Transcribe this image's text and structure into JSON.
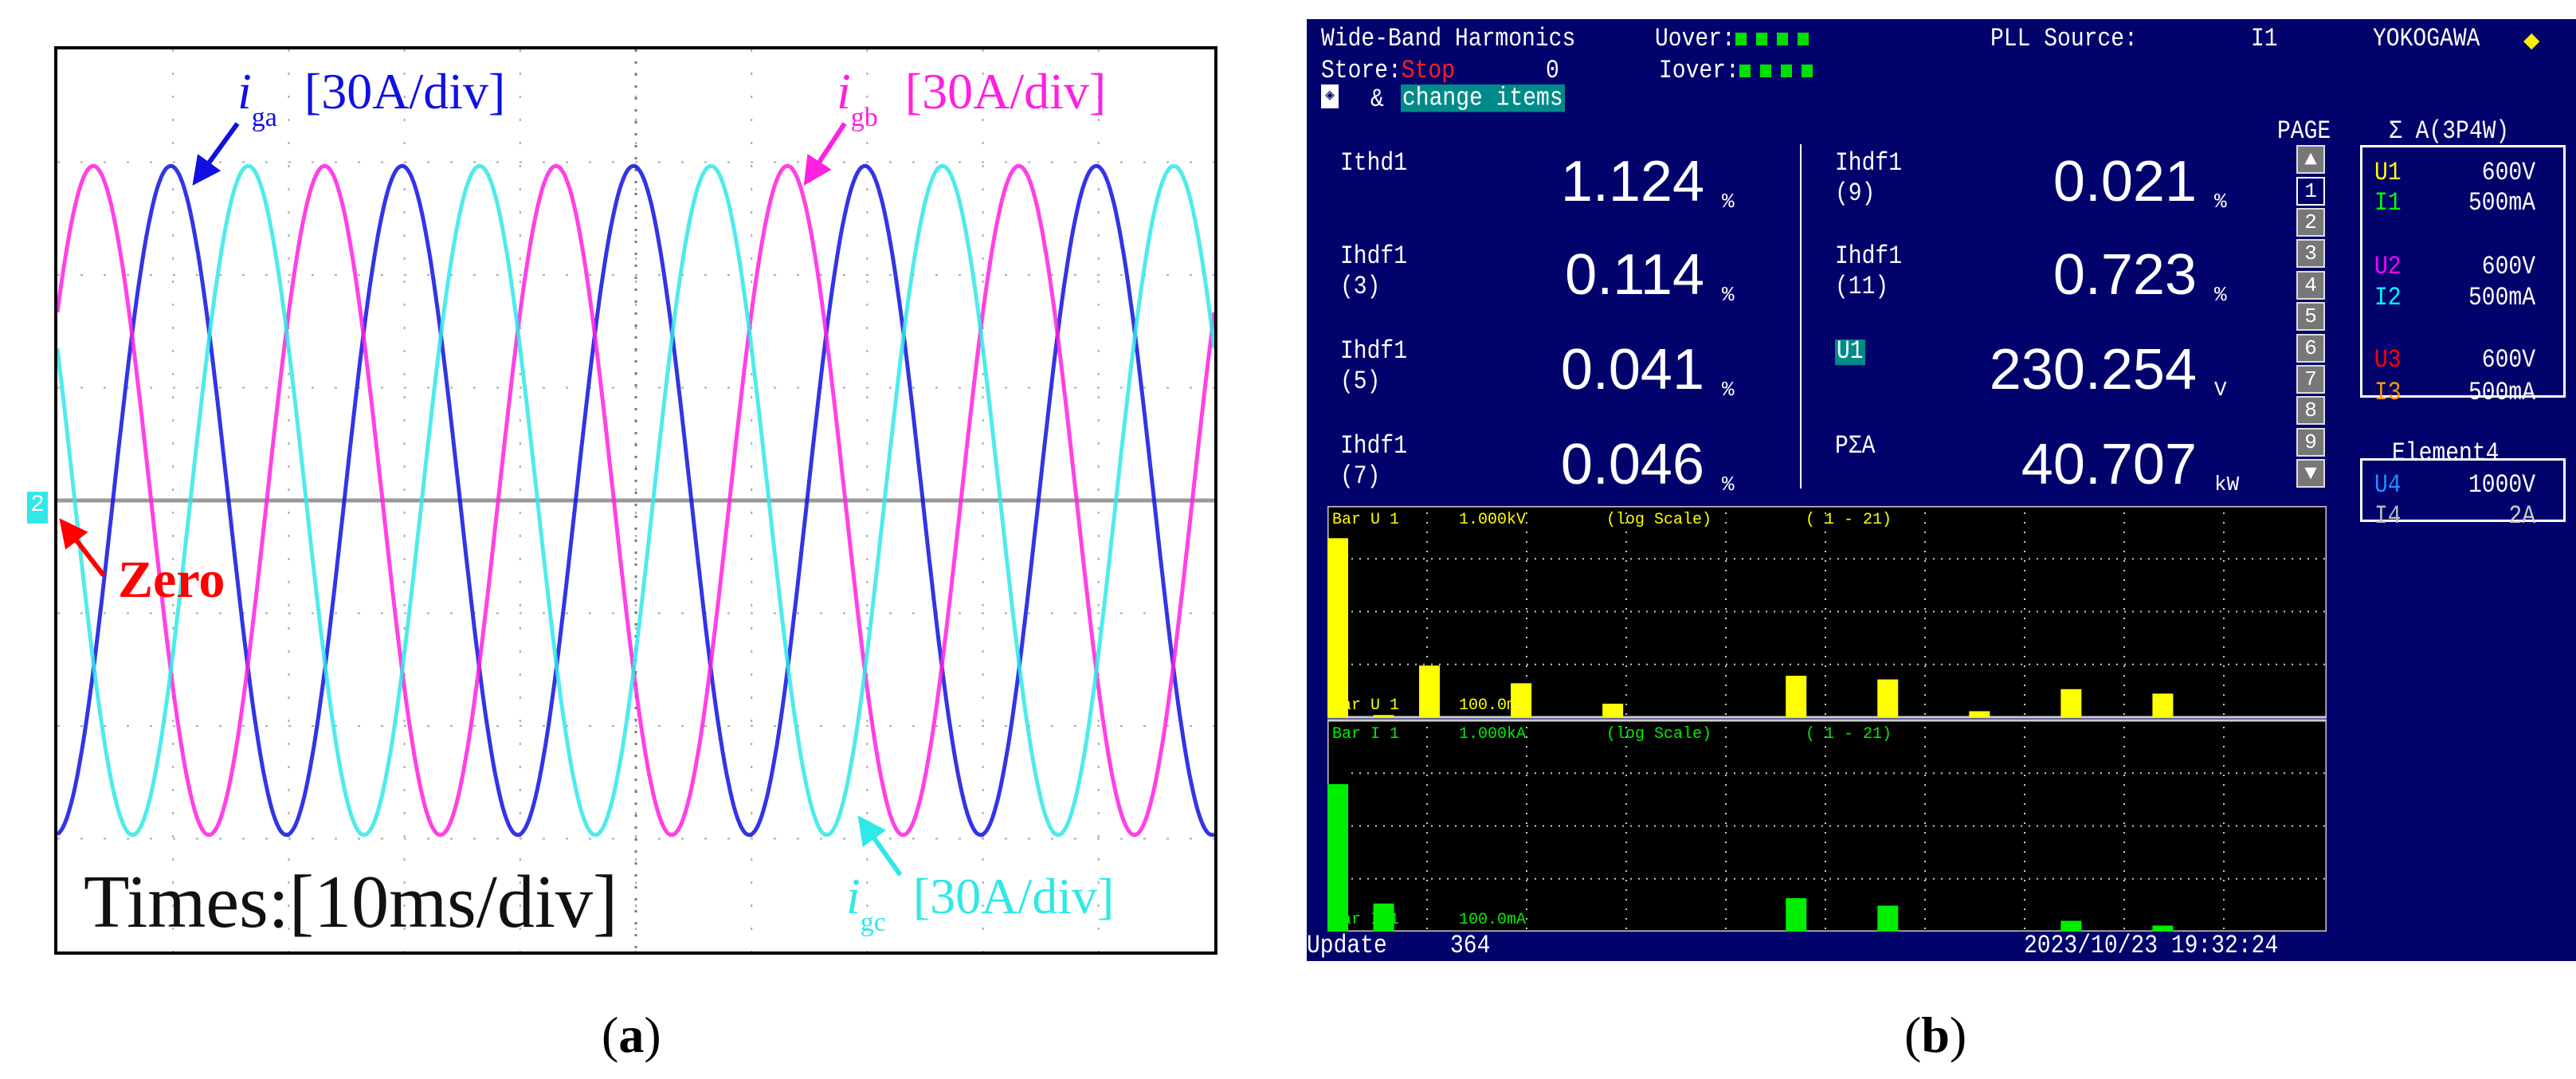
{
  "panel_a": {
    "caption": "a",
    "labels": {
      "iga_sym": "i",
      "iga_sub": "ga",
      "iga_scale": "[30A/div]",
      "igb_sym": "i",
      "igb_sub": "gb",
      "igb_scale": "[30A/div]",
      "igc_sym": "i",
      "igc_sub": "gc",
      "igc_scale": "[30A/div]",
      "time": "Times:[10ms/div]",
      "zero": "Zero",
      "channel_marker": "2"
    }
  },
  "panel_b": {
    "caption": "b",
    "header": {
      "title": "Wide-Band Harmonics",
      "uover": "Uover:",
      "iover": "Iover:",
      "pll_label": "PLL Source:",
      "pll_value": "I1",
      "brand": "YOKOGAWA",
      "store_label": "Store:",
      "store_value": "Stop",
      "store_count": "0",
      "amp": "&",
      "change_items": "change items"
    },
    "measurements": [
      {
        "label": "Ithd1",
        "sub": "",
        "value": "1.124",
        "unit": "%"
      },
      {
        "label": "Ihdf1",
        "sub": "(3)",
        "value": "0.114",
        "unit": "%"
      },
      {
        "label": "Ihdf1",
        "sub": "(5)",
        "value": "0.041",
        "unit": "%"
      },
      {
        "label": "Ihdf1",
        "sub": "(7)",
        "value": "0.046",
        "unit": "%"
      },
      {
        "label": "Ihdf1",
        "sub": "(9)",
        "value": "0.021",
        "unit": "%"
      },
      {
        "label": "Ihdf1",
        "sub": "(11)",
        "value": "0.723",
        "unit": "%"
      },
      {
        "label": "U1",
        "sub": "",
        "value": "230.254",
        "unit": "V"
      },
      {
        "label": "PΣA",
        "sub": "",
        "value": "40.707",
        "unit": "kW"
      }
    ],
    "page": {
      "label": "PAGE",
      "items": [
        "1",
        "2",
        "3",
        "4",
        "5",
        "6",
        "7",
        "8",
        "9"
      ],
      "selected": "1"
    },
    "wiring": {
      "title": "Σ A(3P4W)",
      "ranges": [
        {
          "ch": "U1",
          "val": "600V",
          "color": "#ffff00"
        },
        {
          "ch": "I1",
          "val": "500mA",
          "color": "#00ff00"
        },
        {
          "ch": "U2",
          "val": "600V",
          "color": "#ff00ff"
        },
        {
          "ch": "I2",
          "val": "500mA",
          "color": "#00ffff"
        },
        {
          "ch": "U3",
          "val": "600V",
          "color": "#ff0000"
        },
        {
          "ch": "I3",
          "val": "500mA",
          "color": "#ff9900"
        }
      ],
      "element4_title": "Element4",
      "element4": [
        {
          "ch": "U4",
          "val": "1000V",
          "color": "#1e90ff"
        },
        {
          "ch": "I4",
          "val": "2A",
          "color": "#bbbbbb"
        }
      ]
    },
    "footer": {
      "update_label": "Update",
      "update_value": "364",
      "datetime": "2023/10/23  19:32:24"
    }
  },
  "chart_data": [
    {
      "type": "line",
      "title": "Grid currents",
      "xlabel": "Times:[10ms/div]",
      "ylabel": "[30A/div]",
      "x_range_ms": [
        0,
        100
      ],
      "y_range_A": [
        -120,
        120
      ],
      "grid": true,
      "frequency_hz": 50,
      "series": [
        {
          "name": "iga",
          "color": "#1010e0",
          "amplitude_A": 89,
          "peak_time_ms": 9.8
        },
        {
          "name": "igb",
          "color": "#ff20e0",
          "amplitude_A": 89,
          "peak_time_ms": 3.1
        },
        {
          "name": "igc",
          "color": "#30e8e8",
          "amplitude_A": 89,
          "peak_time_ms": 16.5
        }
      ]
    },
    {
      "type": "bar",
      "title": "Bar U 1",
      "top_label": "1.000kV",
      "bottom_label": "100.0mV",
      "scale_label": "(log Scale)",
      "range_label": "( 1 -  21)",
      "color": "#ffff00",
      "ylim": [
        0.1,
        1000
      ],
      "categories": [
        1,
        2,
        3,
        4,
        5,
        6,
        7,
        8,
        9,
        10,
        11,
        12,
        13,
        14,
        15,
        16,
        17,
        18,
        19,
        20,
        21
      ],
      "values": [
        246,
        0.11,
        0.95,
        0,
        0.44,
        0,
        0.18,
        0,
        0,
        0,
        0.61,
        0,
        0.52,
        0,
        0.13,
        0,
        0.34,
        0,
        0.28,
        0,
        0
      ]
    },
    {
      "type": "bar",
      "title": "Bar I 1",
      "top_label": "1.000kA",
      "bottom_label": "100.0mA",
      "scale_label": "(log Scale)",
      "range_label": "( 1 -  21)",
      "color": "#00ee00",
      "ylim": [
        0.1,
        1000
      ],
      "categories": [
        1,
        2,
        3,
        4,
        5,
        6,
        7,
        8,
        9,
        10,
        11,
        12,
        13,
        14,
        15,
        16,
        17,
        18,
        19,
        20,
        21
      ],
      "values": [
        62,
        0.34,
        0,
        0,
        0,
        0,
        0,
        0,
        0,
        0,
        0.43,
        0,
        0.31,
        0,
        0,
        0,
        0.16,
        0,
        0.13,
        0,
        0
      ]
    }
  ]
}
